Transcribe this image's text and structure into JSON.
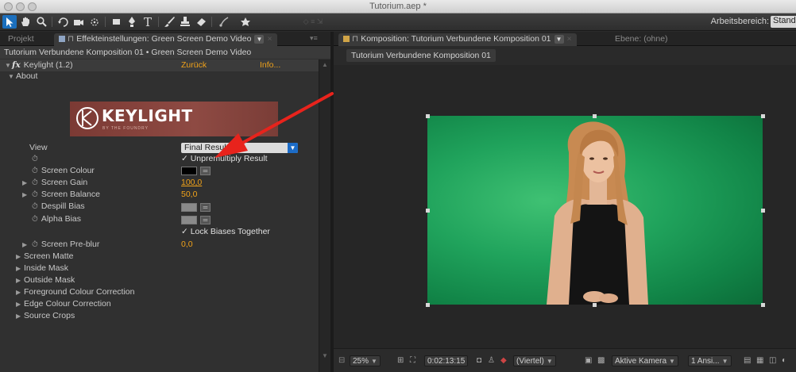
{
  "window": {
    "title": "Tutorium.aep *"
  },
  "toolbar": {
    "workspace_label": "Arbeitsbereich:",
    "workspace_value": "Standard"
  },
  "left_panel": {
    "tabs": [
      {
        "label": "Projekt",
        "active": false
      },
      {
        "label": "Effekteinstellungen: Green Screen Demo Video",
        "active": true
      }
    ],
    "comp_path": "Tutorium Verbundene Komposition 01 • Green Screen Demo Video",
    "effect": {
      "name": "Keylight (1.2)",
      "reset_label": "Zurück",
      "info_label": "Info...",
      "about_label": "About"
    },
    "logo": {
      "text": "KEYLIGHT",
      "subtext": "BY THE FOUNDRY"
    },
    "params": {
      "view_label": "View",
      "view_value": "Final Result",
      "unpremultiply_label": "Unpremultiply Result",
      "screen_colour_label": "Screen Colour",
      "screen_colour_value": "#000000",
      "screen_gain_label": "Screen Gain",
      "screen_gain_value": "100,0",
      "screen_balance_label": "Screen Balance",
      "screen_balance_value": "50,0",
      "despill_bias_label": "Despill Bias",
      "alpha_bias_label": "Alpha Bias",
      "bias_colour": "#8a8a8a",
      "lock_biases_label": "Lock Biases Together",
      "screen_preblur_label": "Screen Pre-blur",
      "screen_preblur_value": "0,0"
    },
    "groups": [
      "Screen Matte",
      "Inside Mask",
      "Outside Mask",
      "Foreground Colour Correction",
      "Edge Colour Correction",
      "Source Crops"
    ]
  },
  "right_panel": {
    "tabs": [
      {
        "label": "Komposition: Tutorium Verbundene Komposition 01",
        "active": true
      },
      {
        "label": "Ebene: (ohne)",
        "active": false
      }
    ],
    "subtab": "Tutorium Verbundene Komposition 01",
    "viewer": {
      "zoom": "25%",
      "timecode": "0:02:13:15",
      "resolution": "(Viertel)",
      "camera": "Aktive Kamera",
      "views": "1 Ansi..."
    }
  },
  "colors": {
    "accent_orange": "#f0a21a",
    "selection_blue": "#1b6fbd",
    "annotation_red": "#e8231c",
    "green_screen": "#20a35c"
  }
}
